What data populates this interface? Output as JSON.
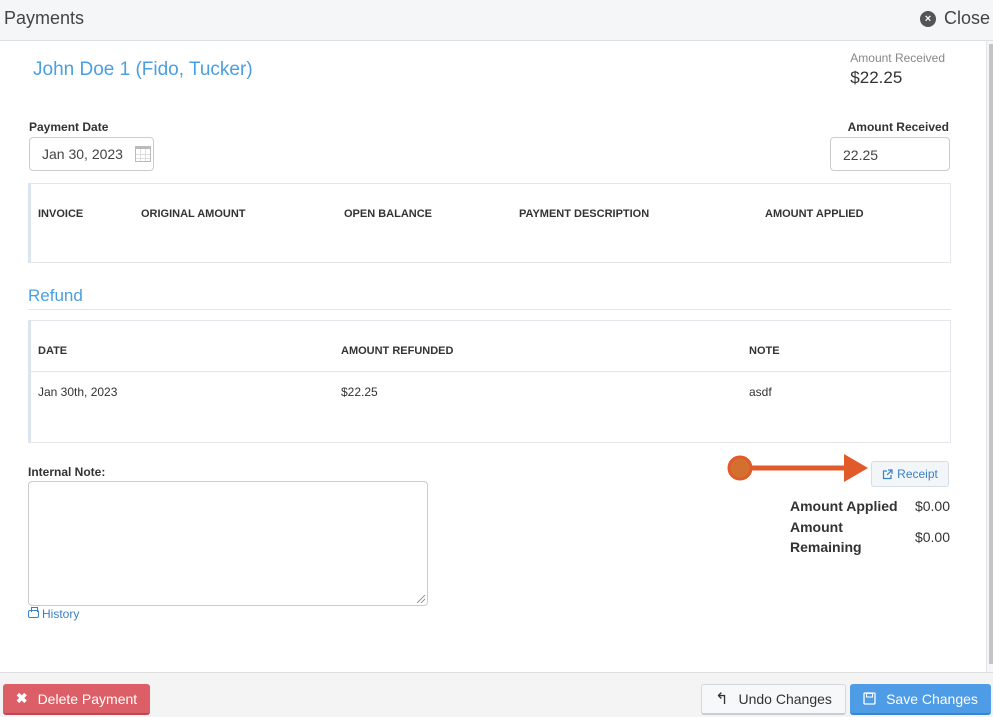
{
  "header": {
    "title": "Payments",
    "close_label": "Close",
    "close_icon": "times-circle-icon"
  },
  "client": {
    "name": "John Doe 1 (Fido, Tucker)"
  },
  "summary": {
    "amount_received_label": "Amount Received",
    "amount_received_value": "$22.25"
  },
  "form": {
    "payment_date_label": "Payment Date",
    "payment_date_value": "Jan 30, 2023",
    "amount_received_label": "Amount Received",
    "amount_received_value": "22.25"
  },
  "invoice_table": {
    "columns": [
      "INVOICE",
      "ORIGINAL AMOUNT",
      "OPEN BALANCE",
      "PAYMENT DESCRIPTION",
      "AMOUNT APPLIED"
    ],
    "rows": []
  },
  "refund": {
    "title": "Refund",
    "columns": [
      "DATE",
      "AMOUNT REFUNDED",
      "NOTE"
    ],
    "rows": [
      {
        "date": "Jan 30th, 2023",
        "amount": "$22.25",
        "note": "asdf"
      }
    ]
  },
  "internal_note": {
    "label": "Internal Note:",
    "value": "",
    "history_link": "History"
  },
  "receipt": {
    "label": "Receipt",
    "icon": "external-link-icon"
  },
  "totals": {
    "applied_label": "Amount Applied",
    "applied_value": "$0.00",
    "remaining_label": "Amount Remaining",
    "remaining_value": "$0.00"
  },
  "annotation": {
    "color": "#e05a2a"
  },
  "footer": {
    "delete_label": "Delete Payment",
    "undo_label": "Undo Changes",
    "save_label": "Save Changes"
  },
  "colors": {
    "accent": "#4a9fe0",
    "danger": "#dc5f67",
    "primary": "#4e9be6",
    "link": "#3a7fc4"
  }
}
